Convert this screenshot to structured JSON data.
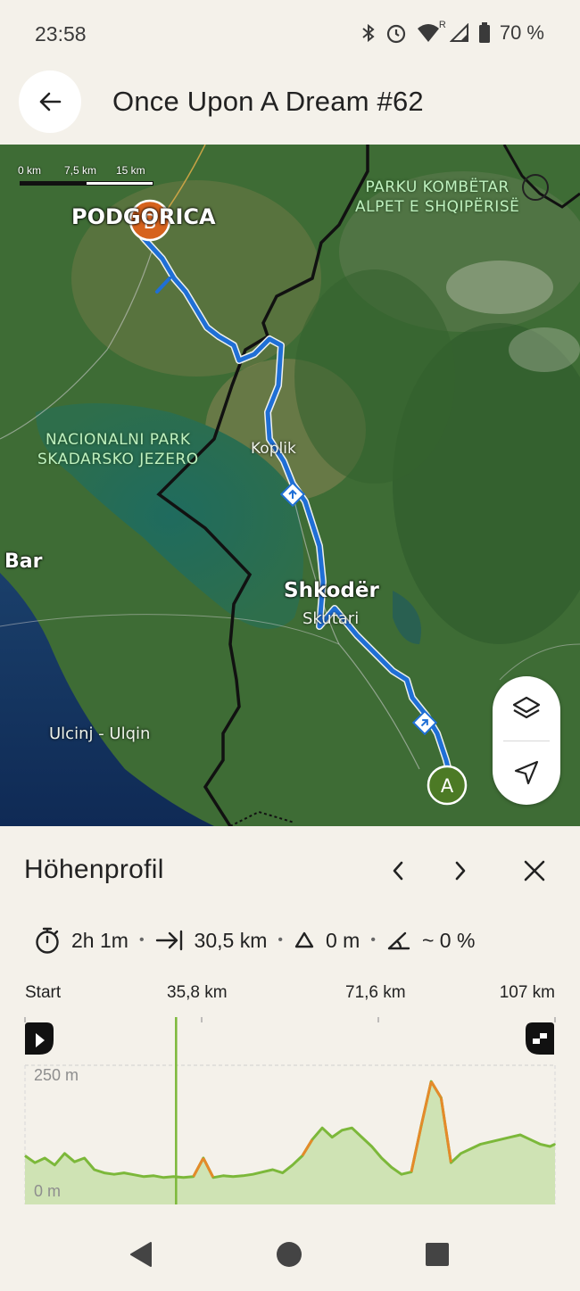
{
  "status_bar": {
    "time": "23:58",
    "network_badge": "R",
    "battery": "70 %",
    "icons": [
      "bluetooth-icon",
      "alarm-icon",
      "wifi-icon",
      "signal-icon",
      "battery-icon"
    ]
  },
  "header": {
    "title": "Once Upon A Dream #62"
  },
  "map": {
    "scale": [
      "0 km",
      "7,5 km",
      "15 km"
    ],
    "labels": {
      "podgorica": "PODGORICA",
      "park_albania": "PARKU KOMBËTAR\nALPET E SHQIPËRISË",
      "park_skadar": "NACIONALNI PARK\nSKADARSKO JEZERO",
      "koplik": "Koplik",
      "bar": "Bar",
      "shkoder": "Shkodër",
      "skutari": "Skutari",
      "ulcinj": "Ulcinj - Ulqin"
    },
    "markers": {
      "start": "A",
      "end": "B"
    },
    "route_color": "#1f6fd6"
  },
  "profile_panel": {
    "title": "Höhenprofil",
    "stats": {
      "duration": "2h 1m",
      "distance": "30,5 km",
      "elevation": "0 m",
      "gradient": "~ 0 %"
    },
    "axis": {
      "start": "Start",
      "tick1": "35,8 km",
      "tick2": "71,6 km",
      "end": "107 km"
    },
    "chart": {
      "max_label": "250 m",
      "min_label": "0 m",
      "cursor_km": 30.5,
      "line_color": "#7cb83a",
      "fill_color": "#cfe3b4",
      "steep_color": "#e58a2a"
    }
  },
  "chart_data": {
    "type": "area",
    "xlabel": "",
    "ylabel": "",
    "xlim": [
      0,
      107
    ],
    "ylim": [
      0,
      250
    ],
    "x": [
      0,
      2,
      4,
      6,
      8,
      10,
      12,
      14,
      16,
      18,
      20,
      22,
      24,
      26,
      28,
      30,
      32,
      34,
      36,
      38,
      40,
      42,
      44,
      46,
      48,
      50,
      52,
      54,
      56,
      58,
      60,
      62,
      64,
      66,
      68,
      70,
      72,
      74,
      76,
      78,
      80,
      82,
      84,
      86,
      88,
      90,
      92,
      94,
      96,
      98,
      100,
      102,
      104,
      106,
      107
    ],
    "series": [
      {
        "values": [
          55,
          40,
          50,
          35,
          60,
          42,
          50,
          25,
          18,
          15,
          18,
          14,
          10,
          12,
          8,
          10,
          8,
          10,
          50,
          8,
          12,
          10,
          12,
          15,
          20,
          25,
          18,
          35,
          55,
          90,
          115,
          95,
          110,
          115,
          95,
          75,
          50,
          30,
          15,
          20,
          120,
          215,
          180,
          40,
          60,
          70,
          80,
          85,
          90,
          95,
          100,
          90,
          80,
          75,
          80
        ]
      }
    ]
  },
  "nav_bar": {
    "icons": [
      "back-triangle-icon",
      "home-circle-icon",
      "recents-square-icon"
    ]
  }
}
